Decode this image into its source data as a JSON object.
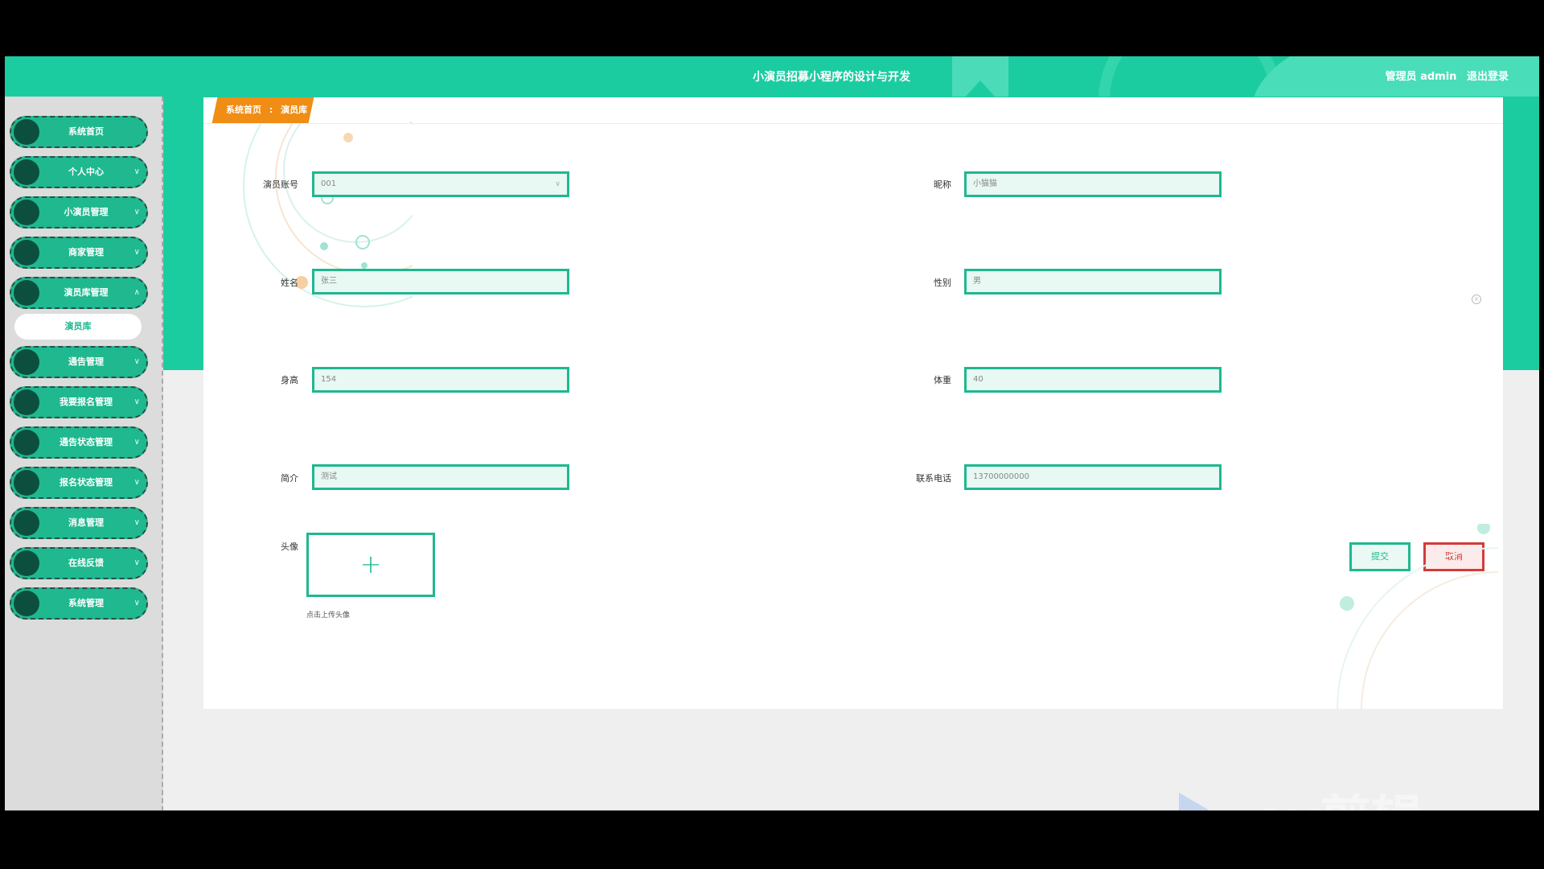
{
  "header": {
    "title": "小演员招募小程序的设计与开发",
    "user_label": "管理员 admin",
    "logout_label": "退出登录"
  },
  "sidebar": {
    "items": [
      {
        "label": "系统首页"
      },
      {
        "label": "个人中心"
      },
      {
        "label": "小演员管理"
      },
      {
        "label": "商家管理"
      },
      {
        "label": "演员库管理"
      },
      {
        "label": "通告管理"
      },
      {
        "label": "我要报名管理"
      },
      {
        "label": "通告状态管理"
      },
      {
        "label": "报名状态管理"
      },
      {
        "label": "消息管理"
      },
      {
        "label": "在线反馈"
      },
      {
        "label": "系统管理"
      }
    ],
    "active_sub": "演员库"
  },
  "breadcrumb": {
    "home": "系统首页",
    "sep": ":",
    "current": "演员库"
  },
  "form": {
    "account": {
      "label": "演员账号",
      "value": "001"
    },
    "nickname": {
      "label": "昵称",
      "value": "小猫猫"
    },
    "name": {
      "label": "姓名",
      "value": "张三"
    },
    "gender": {
      "label": "性别",
      "value": "男"
    },
    "height": {
      "label": "身高",
      "value": "154"
    },
    "weight": {
      "label": "体重",
      "value": "40"
    },
    "intro": {
      "label": "简介",
      "value": "测试"
    },
    "phone": {
      "label": "联系电话",
      "value": "13700000000"
    },
    "avatar": {
      "label": "头像",
      "upload_symbol": "+",
      "tip": "点击上传头像"
    }
  },
  "buttons": {
    "submit": "提交",
    "cancel": "取消"
  },
  "watermark": {
    "text": "ev剪辑"
  },
  "colors": {
    "primary": "#1ccca1",
    "accent_orange": "#f08d14",
    "danger": "#d23c3c",
    "menu_dark": "#0d4f3e"
  }
}
